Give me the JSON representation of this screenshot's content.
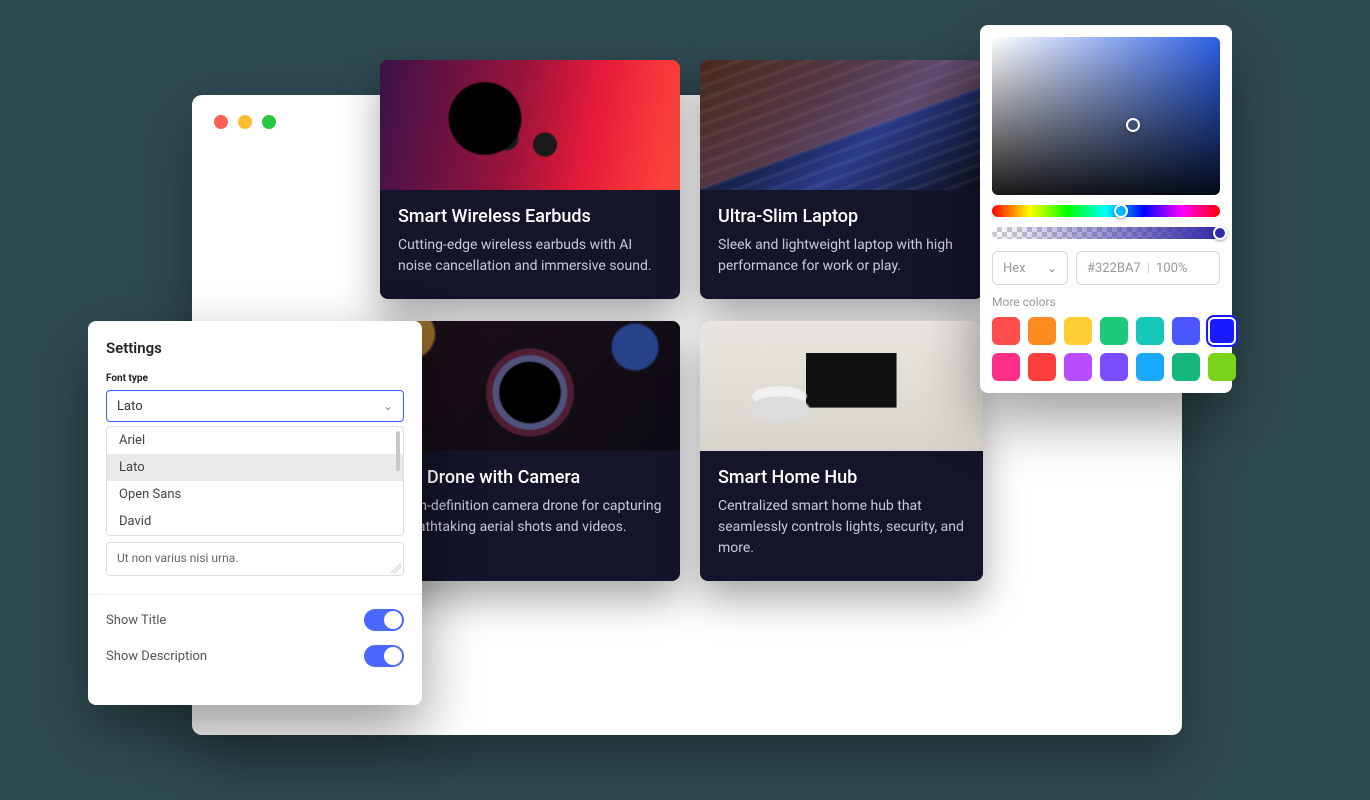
{
  "cards": [
    {
      "title": "Smart Wireless Earbuds",
      "desc": "Cutting-edge wireless earbuds with AI noise cancellation and immersive sound."
    },
    {
      "title": "Ultra-Slim Laptop",
      "desc": "Sleek and lightweight laptop with high performance for work or play."
    },
    {
      "title": "HD Drone with Camera",
      "desc": "High-definition camera drone for capturing breathtaking aerial shots and videos."
    },
    {
      "title": "Smart Home Hub",
      "desc": "Centralized smart home hub that seamlessly controls lights, security, and more."
    }
  ],
  "settings": {
    "title": "Settings",
    "font_type_label": "Font type",
    "font_selected": "Lato",
    "font_options": [
      "Ariel",
      "Lato",
      "Open Sans",
      "David"
    ],
    "textarea_value": "Ut non varius nisi urna.",
    "show_title_label": "Show Title",
    "show_description_label": "Show Description",
    "show_title_on": true,
    "show_description_on": true
  },
  "color_picker": {
    "format_label": "Hex",
    "hex_value": "#322BA7",
    "alpha_value": "100%",
    "more_colors_label": "More colors",
    "swatches": [
      "#ff4d4d",
      "#ff8a1f",
      "#ffcf33",
      "#1fc97a",
      "#14c7b8",
      "#4a56ff",
      "#1a1aff",
      "#ff2e86",
      "#ff3d3d",
      "#b84dff",
      "#7a4dff",
      "#1aa8ff",
      "#14b77a",
      "#7bd31a"
    ],
    "selected_swatch_index": 6
  }
}
